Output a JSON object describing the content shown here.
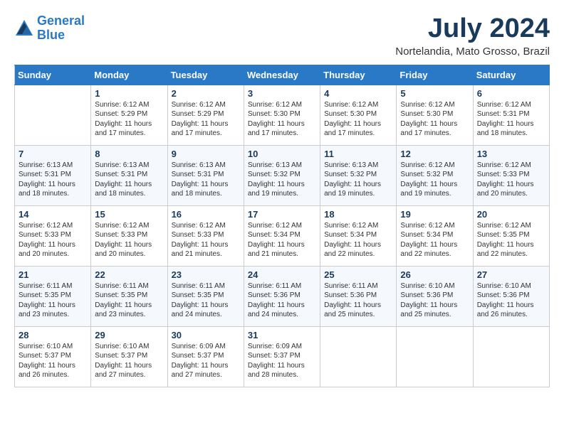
{
  "header": {
    "logo_line1": "General",
    "logo_line2": "Blue",
    "month": "July 2024",
    "location": "Nortelandia, Mato Grosso, Brazil"
  },
  "weekdays": [
    "Sunday",
    "Monday",
    "Tuesday",
    "Wednesday",
    "Thursday",
    "Friday",
    "Saturday"
  ],
  "weeks": [
    [
      {
        "day": "",
        "info": ""
      },
      {
        "day": "1",
        "info": "Sunrise: 6:12 AM\nSunset: 5:29 PM\nDaylight: 11 hours\nand 17 minutes."
      },
      {
        "day": "2",
        "info": "Sunrise: 6:12 AM\nSunset: 5:29 PM\nDaylight: 11 hours\nand 17 minutes."
      },
      {
        "day": "3",
        "info": "Sunrise: 6:12 AM\nSunset: 5:30 PM\nDaylight: 11 hours\nand 17 minutes."
      },
      {
        "day": "4",
        "info": "Sunrise: 6:12 AM\nSunset: 5:30 PM\nDaylight: 11 hours\nand 17 minutes."
      },
      {
        "day": "5",
        "info": "Sunrise: 6:12 AM\nSunset: 5:30 PM\nDaylight: 11 hours\nand 17 minutes."
      },
      {
        "day": "6",
        "info": "Sunrise: 6:12 AM\nSunset: 5:31 PM\nDaylight: 11 hours\nand 18 minutes."
      }
    ],
    [
      {
        "day": "7",
        "info": "Sunrise: 6:13 AM\nSunset: 5:31 PM\nDaylight: 11 hours\nand 18 minutes."
      },
      {
        "day": "8",
        "info": "Sunrise: 6:13 AM\nSunset: 5:31 PM\nDaylight: 11 hours\nand 18 minutes."
      },
      {
        "day": "9",
        "info": "Sunrise: 6:13 AM\nSunset: 5:31 PM\nDaylight: 11 hours\nand 18 minutes."
      },
      {
        "day": "10",
        "info": "Sunrise: 6:13 AM\nSunset: 5:32 PM\nDaylight: 11 hours\nand 19 minutes."
      },
      {
        "day": "11",
        "info": "Sunrise: 6:13 AM\nSunset: 5:32 PM\nDaylight: 11 hours\nand 19 minutes."
      },
      {
        "day": "12",
        "info": "Sunrise: 6:12 AM\nSunset: 5:32 PM\nDaylight: 11 hours\nand 19 minutes."
      },
      {
        "day": "13",
        "info": "Sunrise: 6:12 AM\nSunset: 5:33 PM\nDaylight: 11 hours\nand 20 minutes."
      }
    ],
    [
      {
        "day": "14",
        "info": "Sunrise: 6:12 AM\nSunset: 5:33 PM\nDaylight: 11 hours\nand 20 minutes."
      },
      {
        "day": "15",
        "info": "Sunrise: 6:12 AM\nSunset: 5:33 PM\nDaylight: 11 hours\nand 20 minutes."
      },
      {
        "day": "16",
        "info": "Sunrise: 6:12 AM\nSunset: 5:33 PM\nDaylight: 11 hours\nand 21 minutes."
      },
      {
        "day": "17",
        "info": "Sunrise: 6:12 AM\nSunset: 5:34 PM\nDaylight: 11 hours\nand 21 minutes."
      },
      {
        "day": "18",
        "info": "Sunrise: 6:12 AM\nSunset: 5:34 PM\nDaylight: 11 hours\nand 22 minutes."
      },
      {
        "day": "19",
        "info": "Sunrise: 6:12 AM\nSunset: 5:34 PM\nDaylight: 11 hours\nand 22 minutes."
      },
      {
        "day": "20",
        "info": "Sunrise: 6:12 AM\nSunset: 5:35 PM\nDaylight: 11 hours\nand 22 minutes."
      }
    ],
    [
      {
        "day": "21",
        "info": "Sunrise: 6:11 AM\nSunset: 5:35 PM\nDaylight: 11 hours\nand 23 minutes."
      },
      {
        "day": "22",
        "info": "Sunrise: 6:11 AM\nSunset: 5:35 PM\nDaylight: 11 hours\nand 23 minutes."
      },
      {
        "day": "23",
        "info": "Sunrise: 6:11 AM\nSunset: 5:35 PM\nDaylight: 11 hours\nand 24 minutes."
      },
      {
        "day": "24",
        "info": "Sunrise: 6:11 AM\nSunset: 5:36 PM\nDaylight: 11 hours\nand 24 minutes."
      },
      {
        "day": "25",
        "info": "Sunrise: 6:11 AM\nSunset: 5:36 PM\nDaylight: 11 hours\nand 25 minutes."
      },
      {
        "day": "26",
        "info": "Sunrise: 6:10 AM\nSunset: 5:36 PM\nDaylight: 11 hours\nand 25 minutes."
      },
      {
        "day": "27",
        "info": "Sunrise: 6:10 AM\nSunset: 5:36 PM\nDaylight: 11 hours\nand 26 minutes."
      }
    ],
    [
      {
        "day": "28",
        "info": "Sunrise: 6:10 AM\nSunset: 5:37 PM\nDaylight: 11 hours\nand 26 minutes."
      },
      {
        "day": "29",
        "info": "Sunrise: 6:10 AM\nSunset: 5:37 PM\nDaylight: 11 hours\nand 27 minutes."
      },
      {
        "day": "30",
        "info": "Sunrise: 6:09 AM\nSunset: 5:37 PM\nDaylight: 11 hours\nand 27 minutes."
      },
      {
        "day": "31",
        "info": "Sunrise: 6:09 AM\nSunset: 5:37 PM\nDaylight: 11 hours\nand 28 minutes."
      },
      {
        "day": "",
        "info": ""
      },
      {
        "day": "",
        "info": ""
      },
      {
        "day": "",
        "info": ""
      }
    ]
  ]
}
